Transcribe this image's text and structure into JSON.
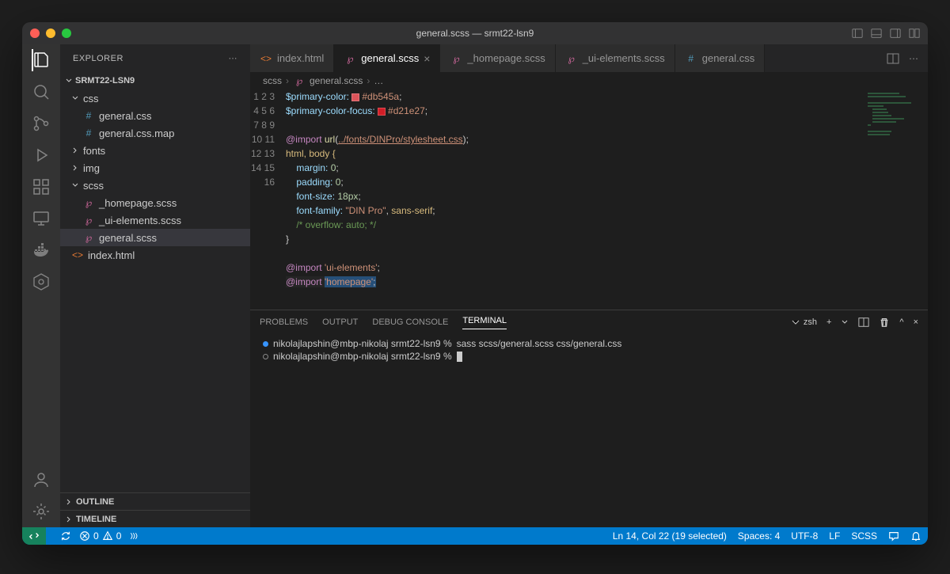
{
  "titlebar": {
    "title": "general.scss — srmt22-lsn9"
  },
  "sidebar": {
    "title": "EXPLORER",
    "project": "SRMT22-LSN9",
    "outline": "OUTLINE",
    "timeline": "TIMELINE"
  },
  "tree": {
    "css": "css",
    "general_css": "general.css",
    "general_css_map": "general.css.map",
    "fonts": "fonts",
    "img": "img",
    "scss": "scss",
    "homepage_scss": "_homepage.scss",
    "uielements_scss": "_ui-elements.scss",
    "general_scss": "general.scss",
    "index_html": "index.html"
  },
  "tabs": {
    "index_html": "index.html",
    "general_scss": "general.scss",
    "homepage_scss": "_homepage.scss",
    "uielements_scss": "_ui-elements.scss",
    "general_css": "general.css"
  },
  "breadcrumb": {
    "scss": "scss",
    "file": "general.scss",
    "more": "…"
  },
  "code": {
    "l1a": "$primary-color:",
    "l1b": "#db545a",
    "l2a": "$primary-color-focus:",
    "l2b": "#d21e27",
    "l4a": "@import",
    "l4b": "url",
    "l4c": "../fonts/DINPro/stylesheet.css",
    "l5": "html, body {",
    "l6a": "margin:",
    "l6b": "0",
    "l7a": "padding:",
    "l7b": "0",
    "l8a": "font-size:",
    "l8b": "18px",
    "l9a": "font-family:",
    "l9b": "\"DIN Pro\"",
    "l9c": "sans-serif",
    "l10": "/* overflow: auto; */",
    "l11": "}",
    "l13a": "@import",
    "l13b": "'ui-elements'",
    "l14a": "@import",
    "l14b": "'homepage'"
  },
  "panel": {
    "problems": "PROBLEMS",
    "output": "OUTPUT",
    "debug": "DEBUG CONSOLE",
    "terminal": "TERMINAL",
    "shell": "zsh"
  },
  "terminal": {
    "prompt1": "nikolajlapshin@mbp-nikolaj srmt22-lsn9 %",
    "cmd1": "sass scss/general.scss css/general.css",
    "prompt2": "nikolajlapshin@mbp-nikolaj srmt22-lsn9 %"
  },
  "status": {
    "errors": "0",
    "warnings": "0",
    "cursor": "Ln 14, Col 22 (19 selected)",
    "spaces": "Spaces: 4",
    "encoding": "UTF-8",
    "eol": "LF",
    "lang": "SCSS"
  }
}
